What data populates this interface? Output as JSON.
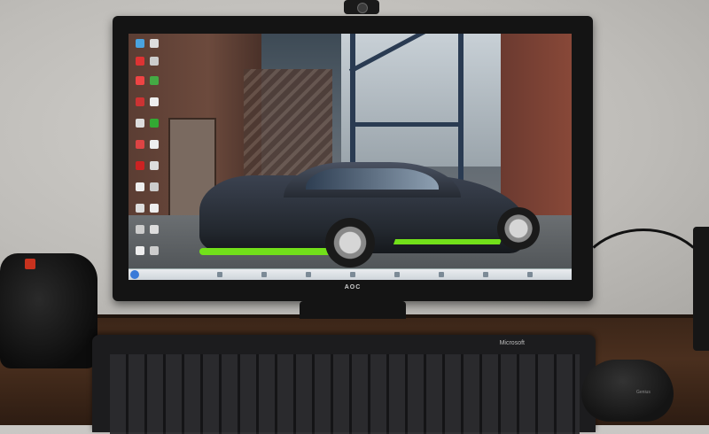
{
  "monitor": {
    "brand": "AOC"
  },
  "keyboard": {
    "brand": "Microsoft"
  },
  "mouse": {
    "brand": "Genius"
  },
  "colors": {
    "accent_green": "#72e01a",
    "car_body": "#2a2f38",
    "desk": "#3a2518",
    "wall": "#c3c1bd"
  }
}
